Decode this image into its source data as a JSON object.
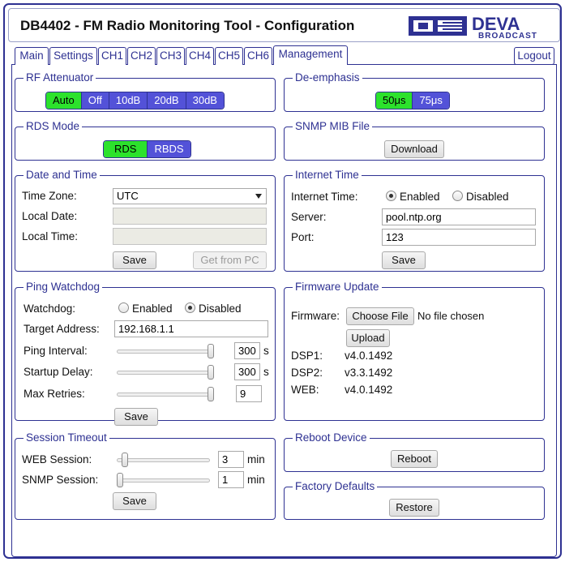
{
  "app": {
    "title": "DB4402 - FM Radio Monitoring Tool - Configuration",
    "logo_brand": "DEVA",
    "logo_sub": "BROADCAST"
  },
  "tabs": [
    {
      "label": "Main"
    },
    {
      "label": "Settings"
    },
    {
      "label": "CH1"
    },
    {
      "label": "CH2"
    },
    {
      "label": "CH3"
    },
    {
      "label": "CH4"
    },
    {
      "label": "CH5"
    },
    {
      "label": "CH6"
    },
    {
      "label": "Management",
      "active": true
    }
  ],
  "logout_label": "Logout",
  "rf_attenuator": {
    "legend": "RF Attenuator",
    "options": [
      "Auto",
      "Off",
      "10dB",
      "20dB",
      "30dB"
    ],
    "selected": "Auto"
  },
  "deemphasis": {
    "legend": "De-emphasis",
    "options": [
      "50μs",
      "75μs"
    ],
    "selected": "50μs"
  },
  "rds_mode": {
    "legend": "RDS Mode",
    "options": [
      "RDS",
      "RBDS"
    ],
    "selected": "RDS"
  },
  "snmp_mib": {
    "legend": "SNMP MIB File",
    "download_label": "Download"
  },
  "date_time": {
    "legend": "Date and Time",
    "timezone_label": "Time Zone:",
    "timezone_value": "UTC",
    "local_date_label": "Local Date:",
    "local_date_value": "",
    "local_time_label": "Local Time:",
    "local_time_value": "",
    "save_label": "Save",
    "get_from_pc_label": "Get from PC"
  },
  "internet_time": {
    "legend": "Internet Time",
    "label": "Internet Time:",
    "enabled_label": "Enabled",
    "disabled_label": "Disabled",
    "selected": "Enabled",
    "server_label": "Server:",
    "server_value": "pool.ntp.org",
    "port_label": "Port:",
    "port_value": "123",
    "save_label": "Save"
  },
  "ping_watchdog": {
    "legend": "Ping Watchdog",
    "watchdog_label": "Watchdog:",
    "enabled_label": "Enabled",
    "disabled_label": "Disabled",
    "selected": "Disabled",
    "target_label": "Target Address:",
    "target_value": "192.168.1.1",
    "interval_label": "Ping Interval:",
    "interval_value": "300",
    "interval_unit": "s",
    "interval_level": 1.0,
    "startup_label": "Startup Delay:",
    "startup_value": "300",
    "startup_unit": "s",
    "startup_level": 1.0,
    "retries_label": "Max Retries:",
    "retries_value": "9",
    "retries_level": 1.0,
    "save_label": "Save"
  },
  "firmware": {
    "legend": "Firmware Update",
    "firmware_label": "Firmware:",
    "choose_label": "Choose File",
    "no_file_text": "No file chosen",
    "upload_label": "Upload",
    "versions": [
      {
        "name": "DSP1:",
        "value": "v4.0.1492"
      },
      {
        "name": "DSP2:",
        "value": "v3.3.1492"
      },
      {
        "name": "WEB:",
        "value": "v4.0.1492"
      }
    ]
  },
  "session_timeout": {
    "legend": "Session Timeout",
    "web_label": "WEB Session:",
    "web_value": "3",
    "web_unit": "min",
    "web_level": 0.06,
    "snmp_label": "SNMP Session:",
    "snmp_value": "1",
    "snmp_unit": "min",
    "snmp_level": 0.0,
    "save_label": "Save"
  },
  "reboot": {
    "legend": "Reboot Device",
    "button_label": "Reboot"
  },
  "factory": {
    "legend": "Factory Defaults",
    "button_label": "Restore"
  },
  "colors": {
    "border": "#2e3192",
    "segment": "#5352d8",
    "selected": "#2ce22c"
  }
}
